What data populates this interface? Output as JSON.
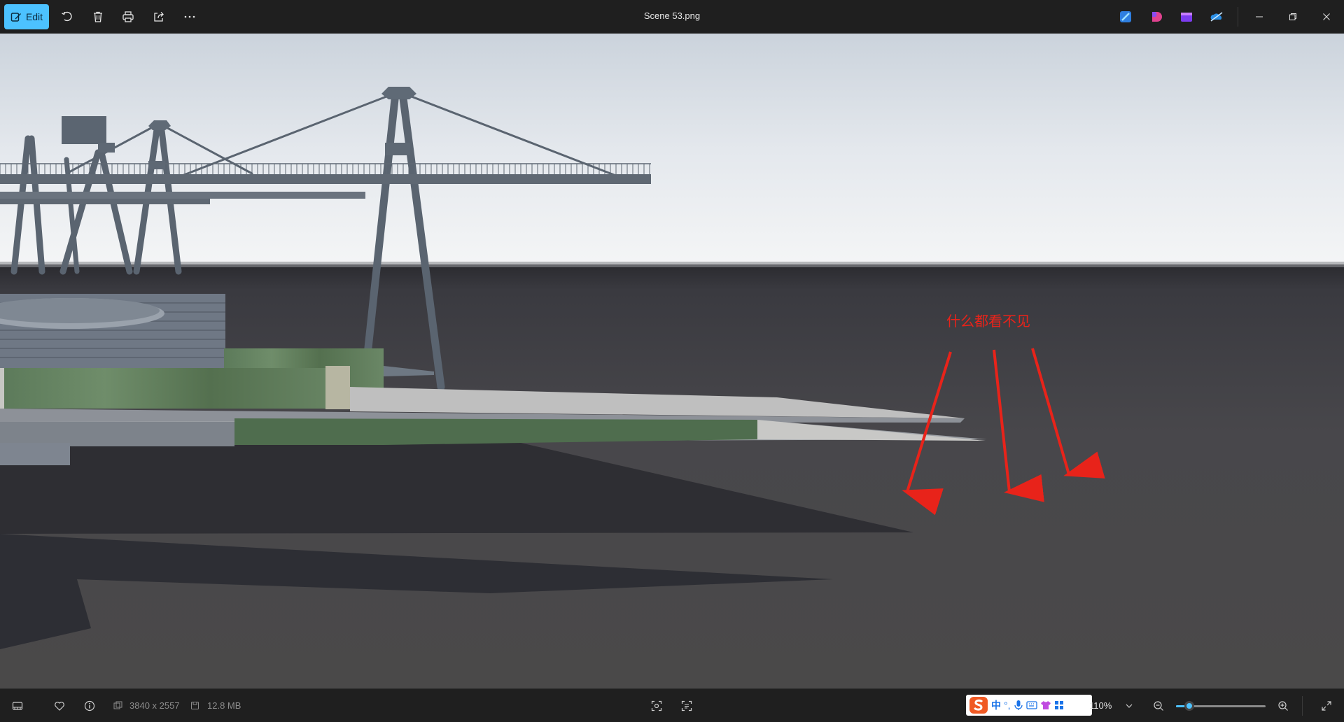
{
  "toolbar": {
    "edit_label": "Edit",
    "title": "Scene 53.png",
    "icons": [
      "edit-icon",
      "rotate-icon",
      "delete-icon",
      "print-icon",
      "share-icon",
      "more-icon"
    ],
    "app_icons": [
      "designer-icon",
      "clipchamp-icon",
      "photos-video-icon",
      "onedrive-icon"
    ],
    "window_controls": [
      "minimize-icon",
      "restore-icon",
      "close-icon"
    ]
  },
  "image": {
    "annotation_text": "什么都看不见",
    "annotation_color": "#e8231a"
  },
  "bottombar": {
    "dimensions": "3840 x 2557",
    "file_size": "12.8 MB",
    "zoom_label": "110%",
    "zoom_fraction": 0.15,
    "ime_labels": [
      "中",
      "°,"
    ],
    "accent_color": "#4cc2ff"
  }
}
